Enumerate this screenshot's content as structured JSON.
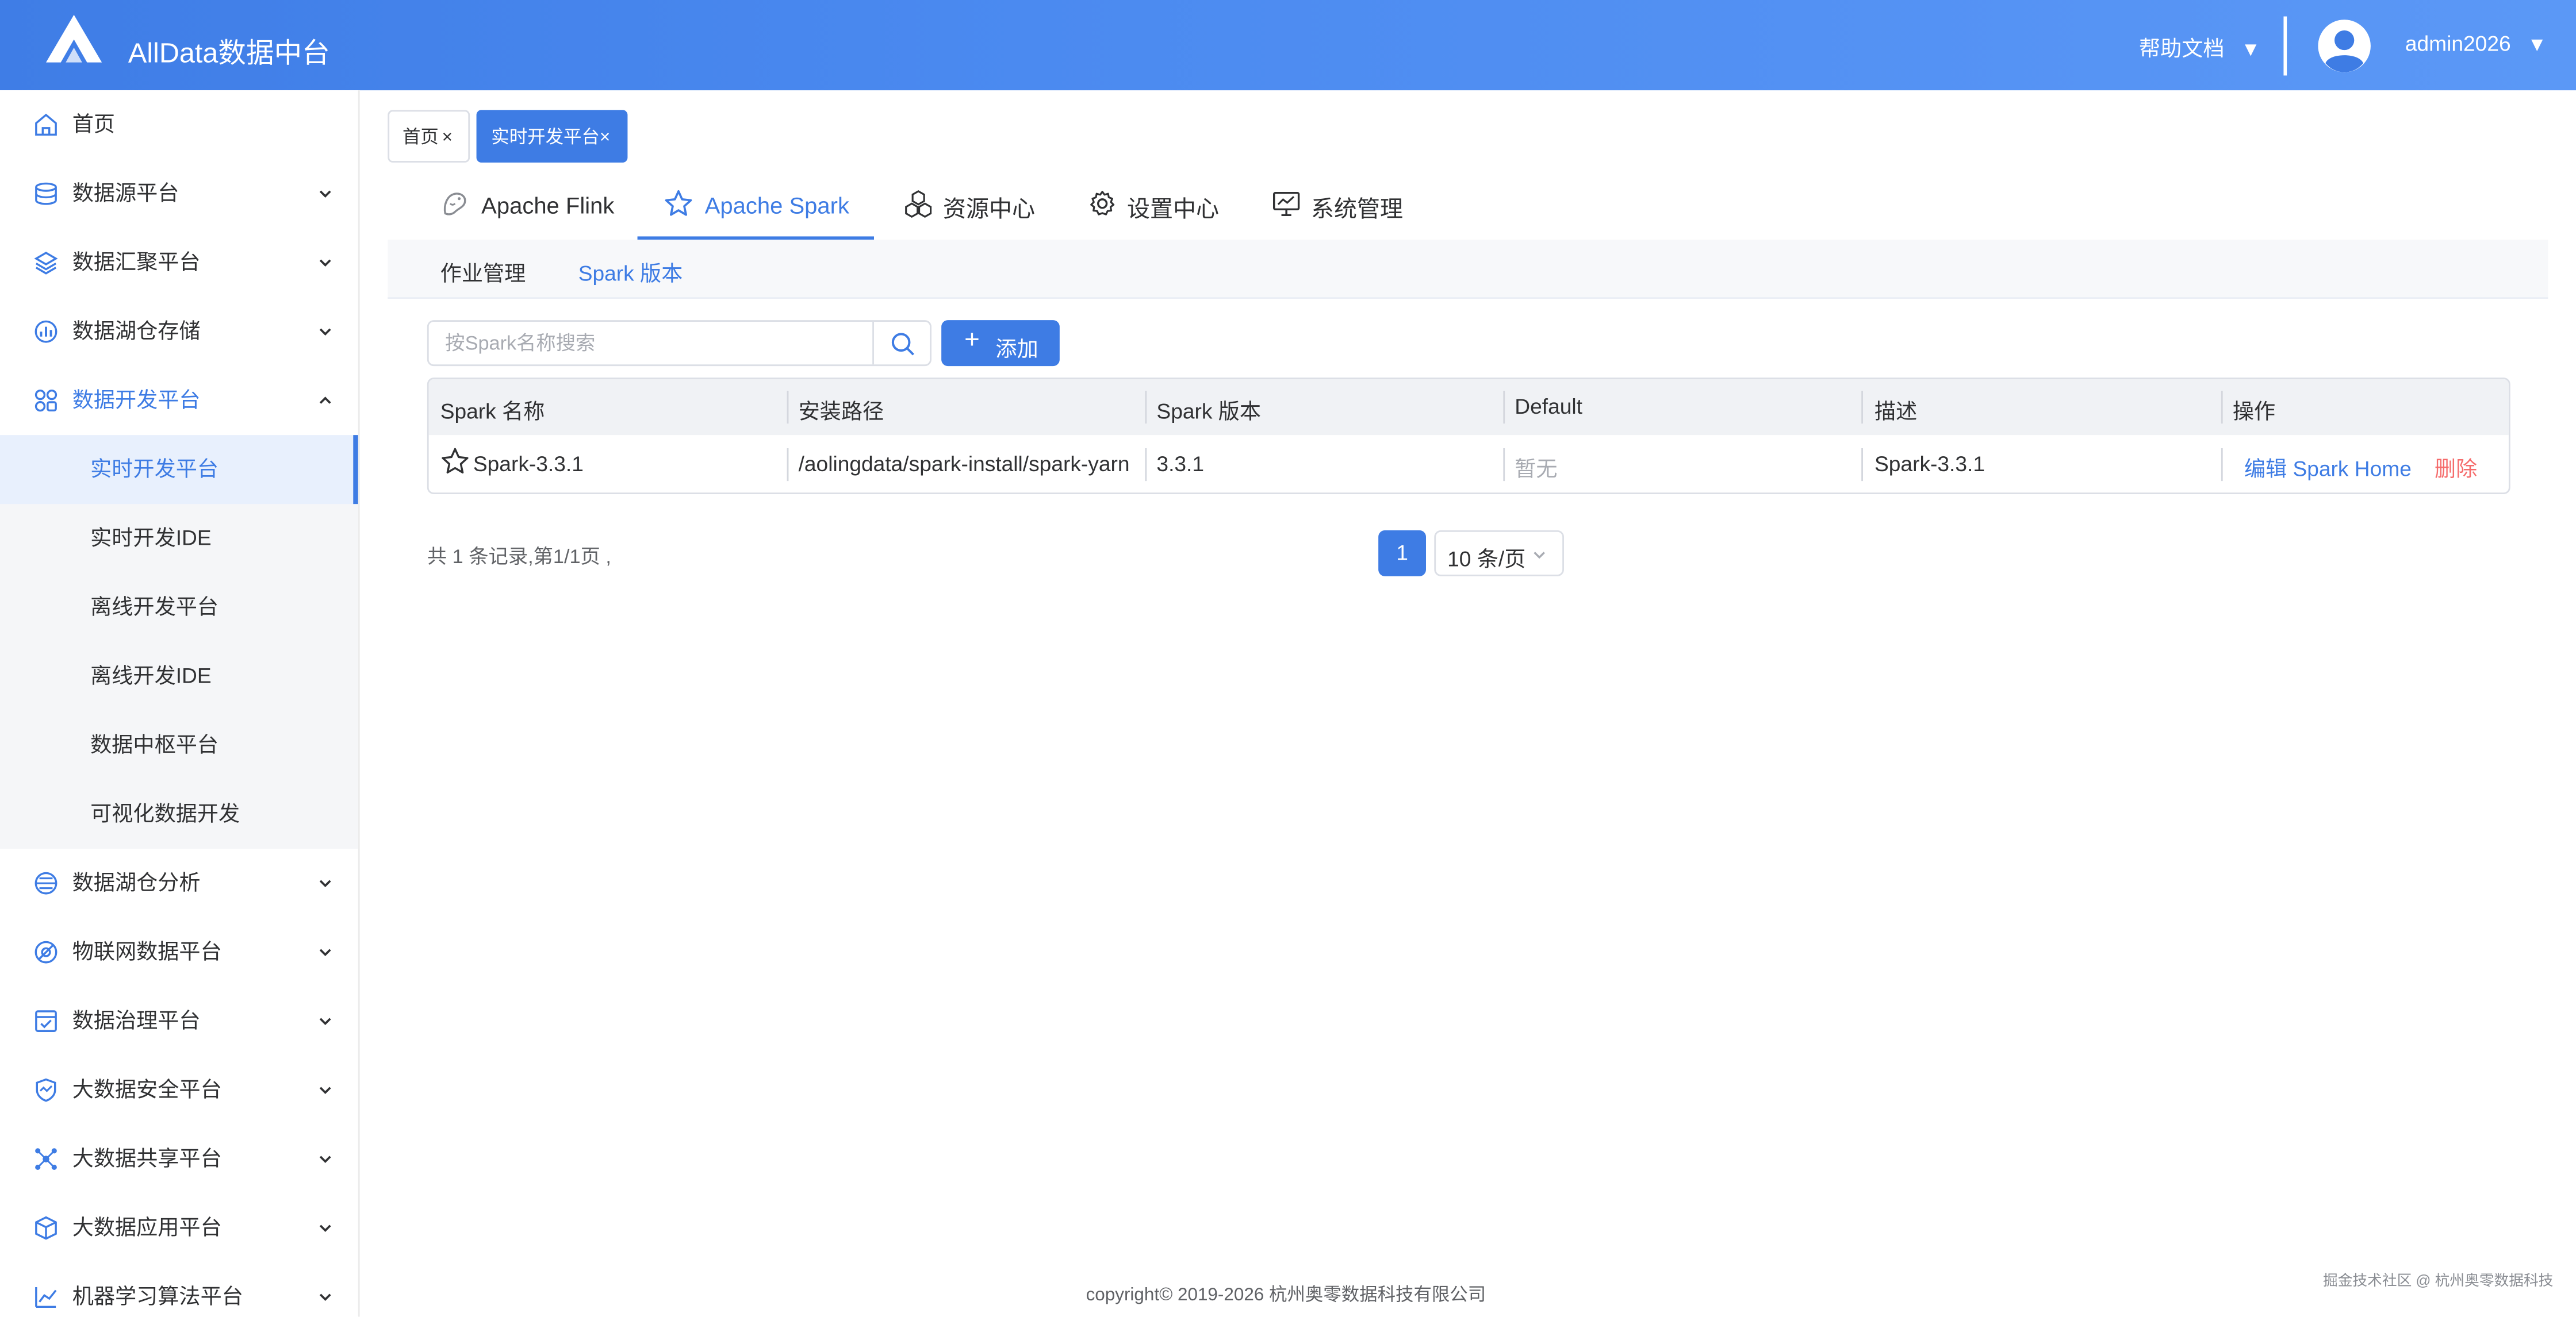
{
  "header": {
    "app_title": "AllData数据中台",
    "help_label": "帮助文档",
    "help_caret": "▼",
    "user_label": "admin2026",
    "user_caret": "▼"
  },
  "sidebar": {
    "items": [
      {
        "label": "首页",
        "icon": "home-icon"
      },
      {
        "label": "数据源平台",
        "icon": "database-icon"
      },
      {
        "label": "数据汇聚平台",
        "icon": "layers-icon"
      },
      {
        "label": "数据湖仓存储",
        "icon": "storage-icon"
      },
      {
        "label": "数据开发平台",
        "icon": "grid-icon"
      },
      {
        "label": "数据湖仓分析",
        "icon": "analysis-icon"
      },
      {
        "label": "物联网数据平台",
        "icon": "iot-icon"
      },
      {
        "label": "数据治理平台",
        "icon": "governance-icon"
      },
      {
        "label": "大数据安全平台",
        "icon": "security-icon"
      },
      {
        "label": "大数据共享平台",
        "icon": "share-icon"
      },
      {
        "label": "大数据应用平台",
        "icon": "cube-icon"
      },
      {
        "label": "机器学习算法平台",
        "icon": "ml-icon"
      }
    ],
    "sub_items": [
      {
        "label": "实时开发平台"
      },
      {
        "label": "实时开发IDE"
      },
      {
        "label": "离线开发平台"
      },
      {
        "label": "离线开发IDE"
      },
      {
        "label": "数据中枢平台"
      },
      {
        "label": "可视化数据开发"
      }
    ]
  },
  "tags": [
    {
      "label": "首页",
      "close": "×"
    },
    {
      "label": "实时开发平台",
      "close": "×"
    }
  ],
  "tabs": [
    {
      "label": "Apache Flink"
    },
    {
      "label": "Apache Spark"
    },
    {
      "label": "资源中心"
    },
    {
      "label": "设置中心"
    },
    {
      "label": "系统管理"
    }
  ],
  "subtabs": [
    {
      "label": "作业管理"
    },
    {
      "label": "Spark 版本"
    }
  ],
  "search": {
    "placeholder": "按Spark名称搜索",
    "value": ""
  },
  "add_button": {
    "plus": "+",
    "label": "添加"
  },
  "table": {
    "columns": [
      "Spark 名称",
      "安装路径",
      "Spark 版本",
      "Default",
      "描述",
      "操作"
    ],
    "rows": [
      {
        "name": "Spark-3.3.1",
        "path": "/aolingdata/spark-install/spark-yarn",
        "version": "3.3.1",
        "default": "暂无",
        "desc": "Spark-3.3.1",
        "action_edit": "编辑 Spark Home",
        "action_delete": "删除"
      }
    ]
  },
  "pagination": {
    "total_text": "共 1 条记录,第1/1页 ,",
    "current_page": "1",
    "page_size": "10 条/页"
  },
  "footer": {
    "copyright": "copyright© 2019-2026 杭州奥零数据科技有限公司",
    "watermark": "掘金技术社区 @ 杭州奥零数据科技"
  },
  "colors": {
    "accent": "#3e7ce4",
    "danger": "#f56c6c",
    "header_gradient_start": "#3f7de6",
    "header_gradient_end": "#5b98f6"
  }
}
